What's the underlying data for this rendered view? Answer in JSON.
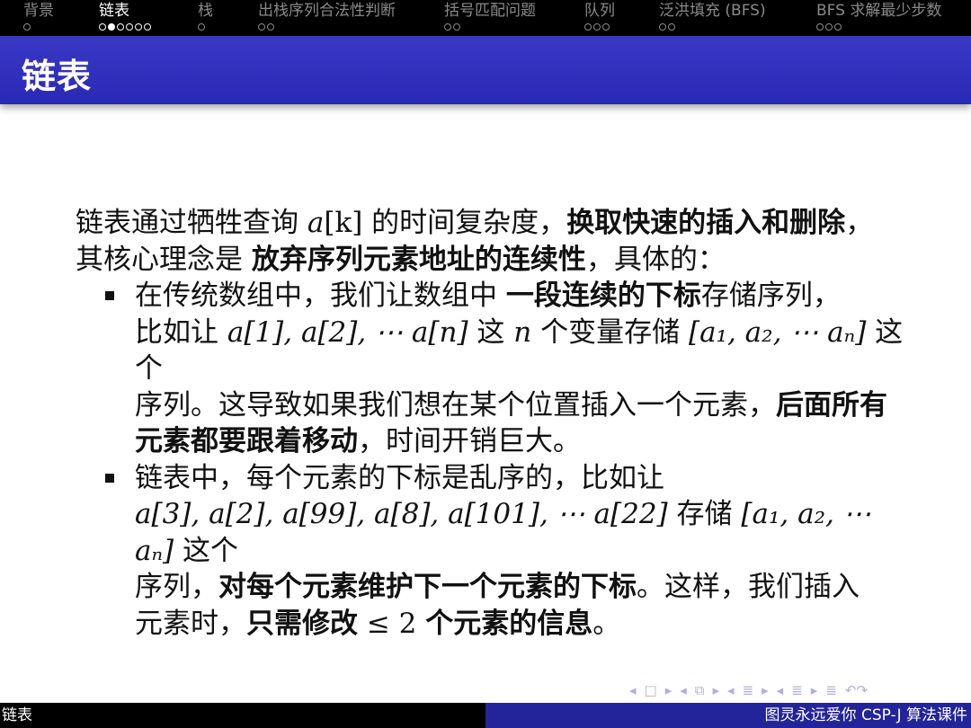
{
  "topnav": [
    {
      "label": "背景",
      "dots": 1,
      "current": -1,
      "active": false
    },
    {
      "label": "链表",
      "dots": 6,
      "current": 1,
      "active": true
    },
    {
      "label": "栈",
      "dots": 1,
      "current": -1,
      "active": false
    },
    {
      "label": "出栈序列合法性判断",
      "dots": 2,
      "current": -1,
      "active": false
    },
    {
      "label": "括号匹配问题",
      "dots": 2,
      "current": -1,
      "active": false
    },
    {
      "label": "队列",
      "dots": 3,
      "current": -1,
      "active": false
    },
    {
      "label": "泛洪填充 (BFS)",
      "dots": 2,
      "current": -1,
      "active": false
    },
    {
      "label": "BFS 求解最少步数",
      "dots": 3,
      "current": -1,
      "active": false
    }
  ],
  "frame_title": "链表",
  "body": {
    "intro_1": "链表通过牺牲查询 ",
    "intro_a": "a",
    "intro_k": "[k]",
    "intro_2": " 的时间复杂度，",
    "intro_bold_1": "换取快速的插入和删除",
    "intro_3": "，",
    "intro_4": "其核心理念是 ",
    "intro_bold_2": "放弃序列元素地址的连续性",
    "intro_5": "，具体的：",
    "b1_1": "在传统数组中，我们让数组中 ",
    "b1_bold_1": "一段连续的下标",
    "b1_2": "存储序列，",
    "b1_3": "比如让 ",
    "b1_math_1": "a[1], a[2], ⋯ a[n]",
    "b1_4": " 这 ",
    "b1_n": "n",
    "b1_5": " 个变量存储 ",
    "b1_math_2": "[a₁, a₂, ⋯ aₙ]",
    "b1_6": " 这个",
    "b1_7": "序列。这导致如果我们想在某个位置插入一个元素，",
    "b1_bold_2": "后面所有元素都要跟着移动",
    "b1_8": "，时间开销巨大。",
    "b2_1": "链表中，每个元素的下标是乱序的，比如让",
    "b2_math_1": "a[3], a[2], a[99], a[8], a[101], ⋯ a[22]",
    "b2_2": " 存储 ",
    "b2_math_2": "[a₁, a₂, ⋯ aₙ]",
    "b2_3": " 这个",
    "b2_4": "序列，",
    "b2_bold_1": "对每个元素维护下一个元素的下标",
    "b2_5": "。这样，我们插入",
    "b2_6": "元素时，",
    "b2_bold_2": "只需修改",
    "b2_math_3": " ≤ 2 ",
    "b2_bold_3": "个元素的信息",
    "b2_7": "。"
  },
  "navsymbols": [
    "◂",
    "□",
    "▸",
    "◂",
    "⧉",
    "▸",
    "◂",
    "≣",
    "▸",
    "◂",
    "≣",
    "▸",
    "≣",
    "↶↷"
  ],
  "footer": {
    "left": "链表",
    "right": "图灵永远爱你 CSP-J 算法课件"
  },
  "colors": {
    "title_bar": "#2f2fbf",
    "footer_right": "#23239a",
    "top_bar": "#000000"
  }
}
